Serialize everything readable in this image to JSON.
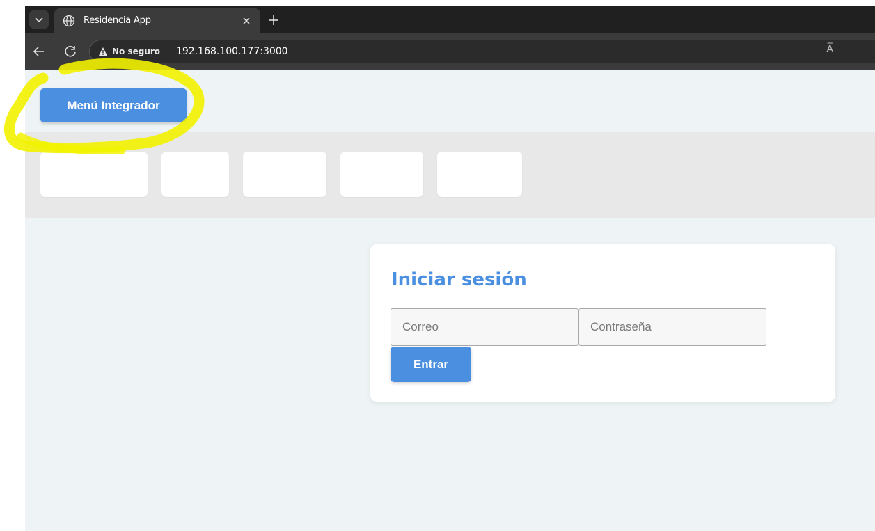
{
  "browser": {
    "tab": {
      "title": "Residencia App"
    },
    "security_label": "No seguro",
    "url": "192.168.100.177:3000",
    "read_aloud_glyph": "A̅"
  },
  "page": {
    "menu_button": "Menú Integrador",
    "nav_cards": [
      {
        "label": ""
      },
      {
        "label": ""
      },
      {
        "label": ""
      },
      {
        "label": ""
      },
      {
        "label": ""
      }
    ],
    "login": {
      "title": "Iniciar sesión",
      "email_placeholder": "Correo",
      "email_value": "",
      "password_placeholder": "Contraseña",
      "password_value": "",
      "submit_label": "Entrar"
    }
  },
  "colors": {
    "accent": "#4a8fe0",
    "page_background": "#eef4f5",
    "nav_strip": "#e8e8e8",
    "highlighter": "#f2f200"
  },
  "icons": [
    "tab-list-icon",
    "globe-icon",
    "close-icon",
    "plus-icon",
    "back-arrow-icon",
    "reload-icon",
    "warning-icon",
    "read-aloud-icon"
  ]
}
